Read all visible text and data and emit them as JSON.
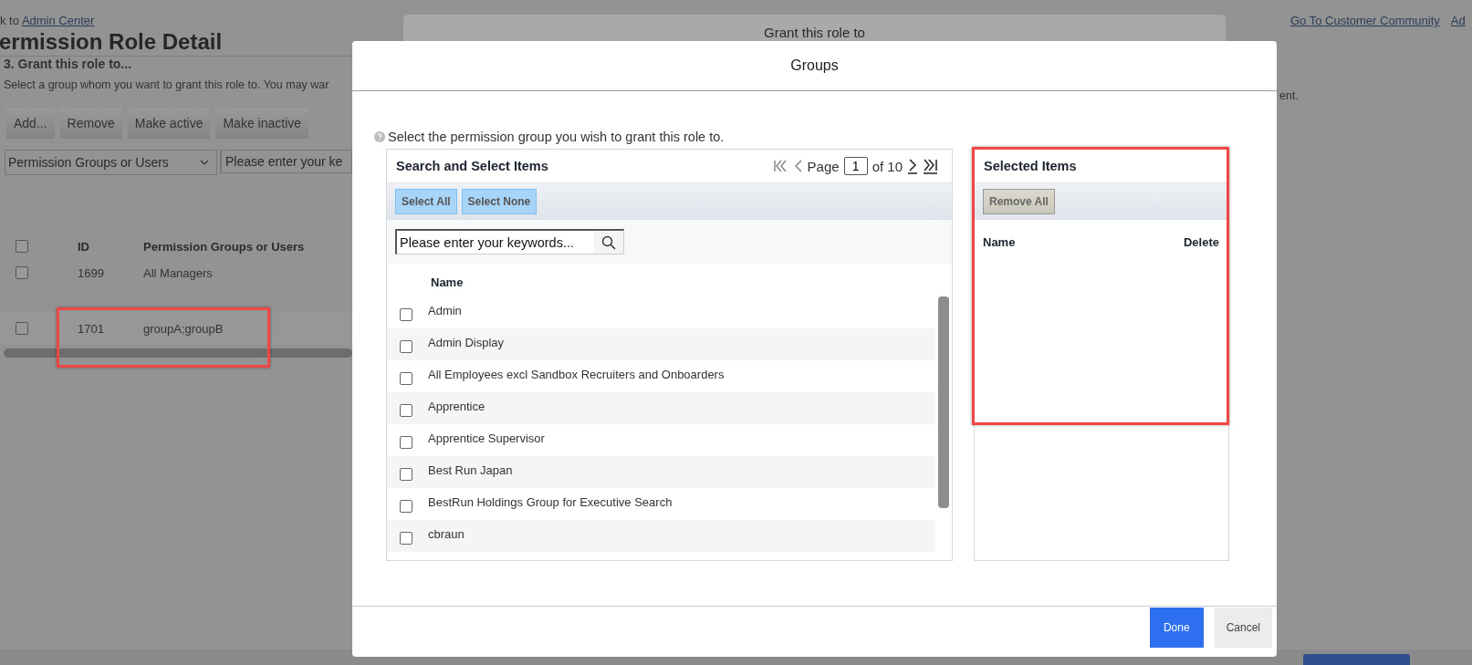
{
  "background_page": {
    "breadcrumb": {
      "prefix": "k to",
      "link": "Admin Center"
    },
    "title": "ermission Role Detail",
    "top_links": [
      "Go To Customer Community",
      "Ad"
    ],
    "section_heading": "3. Grant this role to...",
    "instructions": [
      "Select a group whom you want to grant this role to. You may war",
      "ent."
    ],
    "buttons": [
      "Add...",
      "Remove",
      "Make active",
      "Make inactive"
    ],
    "filter": {
      "value": "Permission Groups or Users",
      "search_placeholder": "Please enter your ke"
    },
    "table": {
      "columns": [
        "ID",
        "Permission Groups or Users"
      ],
      "header_checked": false,
      "rows": [
        {
          "id": "1699",
          "name": "All Managers",
          "checked": false
        },
        {
          "id": "1701",
          "name": "groupA;groupB",
          "checked": false
        }
      ]
    }
  },
  "back_dialog": {
    "title": "Grant this role to"
  },
  "dialog": {
    "title": "Groups",
    "hint": "Select the permission group you wish to grant this role to.",
    "search_panel": {
      "title": "Search and Select Items",
      "pager": {
        "label": "Page",
        "page": "1",
        "of": "of 10"
      },
      "buttons": [
        "Select All",
        "Select None"
      ],
      "search_placeholder": "Please enter your keywords...",
      "column": "Name",
      "items": [
        {
          "name": "Admin",
          "checked": false
        },
        {
          "name": "Admin Display",
          "checked": false
        },
        {
          "name": "All Employees excl Sandbox Recruiters and Onboarders",
          "checked": false
        },
        {
          "name": "Apprentice",
          "checked": false
        },
        {
          "name": "Apprentice Supervisor",
          "checked": false
        },
        {
          "name": "Best Run Japan",
          "checked": false
        },
        {
          "name": "BestRun Holdings Group for Executive Search",
          "checked": false
        },
        {
          "name": "cbraun",
          "checked": false
        }
      ]
    },
    "selected_panel": {
      "title": "Selected Items",
      "button": "Remove All",
      "columns": [
        "Name",
        "Delete"
      ]
    },
    "footer_buttons": [
      {
        "label": "Done",
        "kind": "primary"
      },
      {
        "label": "Cancel",
        "kind": "secondary"
      }
    ]
  }
}
